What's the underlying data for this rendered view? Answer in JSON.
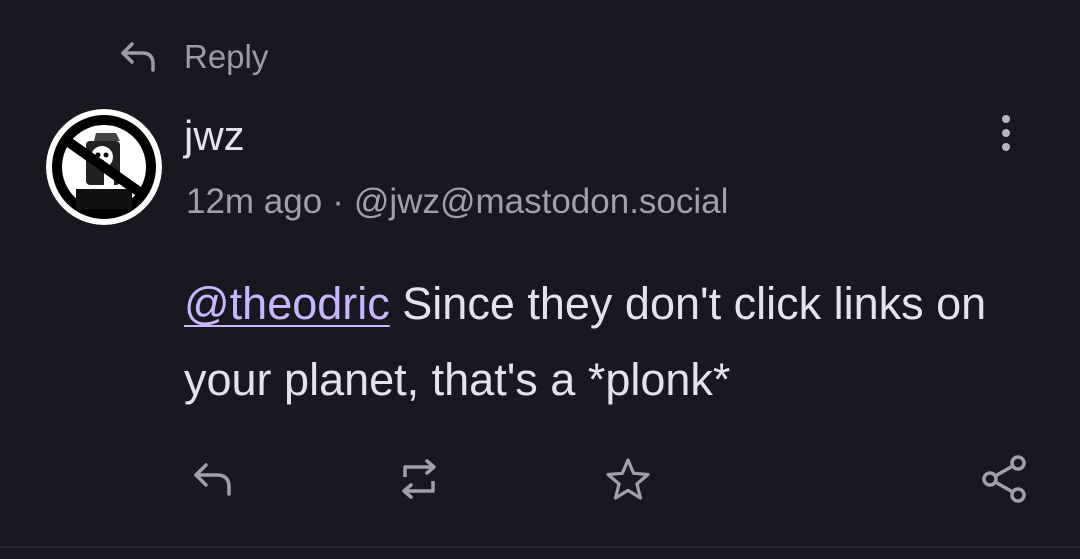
{
  "context": {
    "label": "Reply",
    "icon": "reply-icon"
  },
  "author": {
    "display_name": "jwz",
    "time_ago": "12m ago",
    "separator": "·",
    "handle": "@jwz@mastodon.social",
    "avatar": "jwz-avatar"
  },
  "content": {
    "mention": "@theodric",
    "text": " Since they don't click links on your planet, that's a *plonk*"
  },
  "actions": [
    {
      "name": "reply",
      "icon": "reply-icon"
    },
    {
      "name": "boost",
      "icon": "repeat-icon"
    },
    {
      "name": "favourite",
      "icon": "star-icon"
    },
    {
      "name": "share",
      "icon": "share-icon"
    }
  ],
  "colors": {
    "background": "#191720",
    "text": "#e6e1ec",
    "muted": "#a29eac",
    "mention": "#c8b6ff"
  }
}
